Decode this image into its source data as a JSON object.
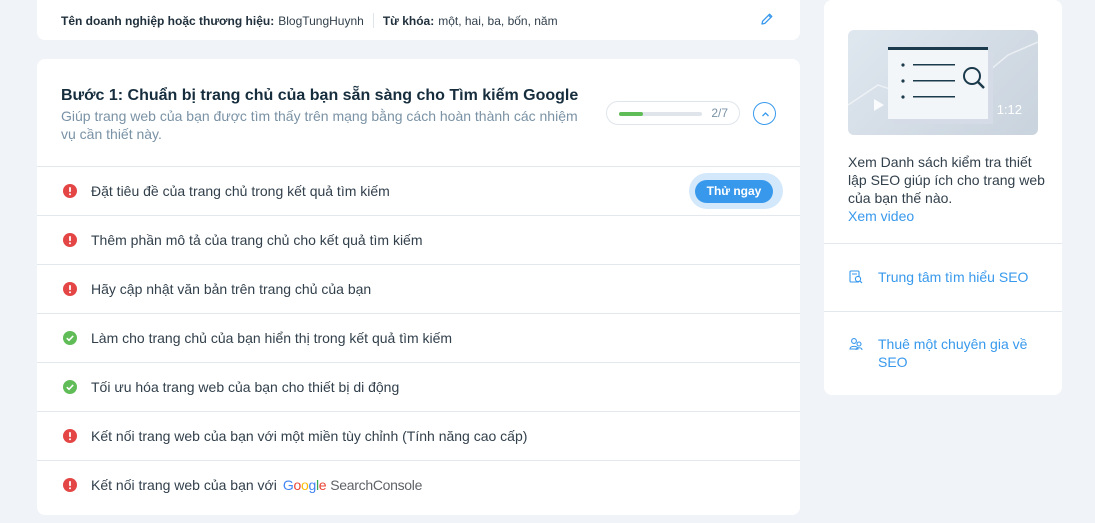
{
  "business": {
    "name_label": "Tên doanh nghiệp hoặc thương hiệu:",
    "name_value": "BlogTungHuynh",
    "keywords_label": "Từ khóa:",
    "keywords_value": "một, hai, ba, bốn, năm"
  },
  "step": {
    "title": "Bước 1: Chuẩn bị trang chủ của bạn sẵn sàng cho Tìm kiếm Google",
    "subtitle": "Giúp trang web của bạn được tìm thấy trên mạng bằng cách hoàn thành các nhiệm vụ cần thiết này.",
    "progress_label": "2/7",
    "progress_fraction": 0.2857
  },
  "tasks": [
    {
      "label": "Đặt tiêu đề của trang chủ trong kết quả tìm kiếm",
      "status": "error",
      "action": "Thử ngay"
    },
    {
      "label": "Thêm phần mô tả của trang chủ cho kết quả tìm kiếm",
      "status": "error"
    },
    {
      "label": "Hãy cập nhật văn bản trên trang chủ của bạn",
      "status": "error"
    },
    {
      "label": "Làm cho trang chủ của bạn hiển thị trong kết quả tìm kiếm",
      "status": "done"
    },
    {
      "label": "Tối ưu hóa trang web của bạn cho thiết bị di động",
      "status": "done"
    },
    {
      "label": "Kết nối trang web của bạn với một miền tùy chỉnh (Tính năng cao cấp)",
      "status": "error"
    },
    {
      "label": "Kết nối trang web của bạn với",
      "status": "error",
      "logo_google": [
        "G",
        "o",
        "o",
        "g",
        "l",
        "e"
      ],
      "logo_suffix": "SearchConsole"
    }
  ],
  "side": {
    "video_duration": "1:12",
    "description": "Xem Danh sách kiểm tra thiết lập SEO giúp ích cho trang web của bạn thế nào.",
    "video_link": "Xem video",
    "learn_link": "Trung tâm tìm hiểu SEO",
    "hire_link": "Thuê một chuyên gia về SEO"
  },
  "colors": {
    "accent": "#3899ec",
    "error": "#e44545",
    "success": "#60bc57"
  },
  "icons": {
    "edit": "pencil-icon",
    "collapse": "chevron-up-icon",
    "error": "exclamation-circle-icon",
    "done": "check-circle-icon",
    "play": "play-icon",
    "learn": "search-doc-icon",
    "hire": "people-icon"
  }
}
